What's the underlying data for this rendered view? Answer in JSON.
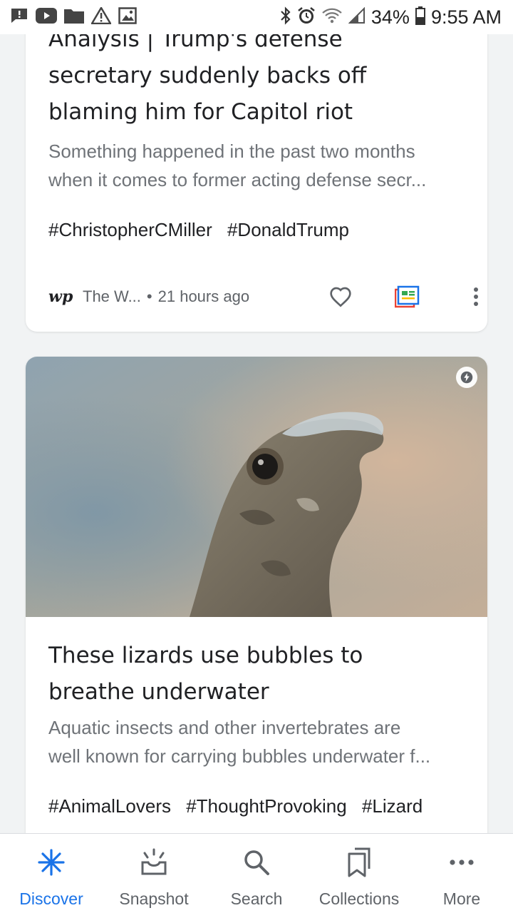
{
  "status_bar": {
    "battery": "34%",
    "time": "9:55 AM",
    "notification_icons": [
      "message-icon",
      "youtube-icon",
      "folder-icon",
      "warning-icon",
      "image-icon"
    ],
    "system_icons": [
      "bluetooth-icon",
      "alarm-icon",
      "wifi-icon",
      "signal-icon",
      "battery-icon"
    ]
  },
  "feed": {
    "cards": [
      {
        "headline_lines": [
          "Analysis | Trump's defense",
          "secretary suddenly backs off",
          "blaming him for Capitol riot"
        ],
        "snippet_lines": [
          "Something happened in the past two months",
          "when it comes to former acting defense secr..."
        ],
        "tags": [
          "#ChristopherCMiller",
          "#DonaldTrump"
        ],
        "source_logo": "wp",
        "source": "The W...",
        "separator": "•",
        "time": "21 hours ago"
      },
      {
        "image_subject": "lizard-photo",
        "headline_lines": [
          "These lizards use bubbles to",
          "breathe underwater"
        ],
        "snippet_lines": [
          "Aquatic insects and other invertebrates are",
          "well known for carrying bubbles underwater f..."
        ],
        "tags": [
          "#AnimalLovers",
          "#ThoughtProvoking",
          "#Lizard"
        ]
      }
    ]
  },
  "bottom_nav": {
    "items": [
      {
        "label": "Discover",
        "icon": "discover-icon",
        "active": true
      },
      {
        "label": "Snapshot",
        "icon": "snapshot-icon",
        "active": false
      },
      {
        "label": "Search",
        "icon": "search-icon",
        "active": false
      },
      {
        "label": "Collections",
        "icon": "collections-icon",
        "active": false
      },
      {
        "label": "More",
        "icon": "more-icon",
        "active": false
      }
    ]
  },
  "colors": {
    "accent": "#1a73e8",
    "background": "#f1f3f4",
    "card": "#ffffff",
    "muted_text": "#6f7378"
  }
}
